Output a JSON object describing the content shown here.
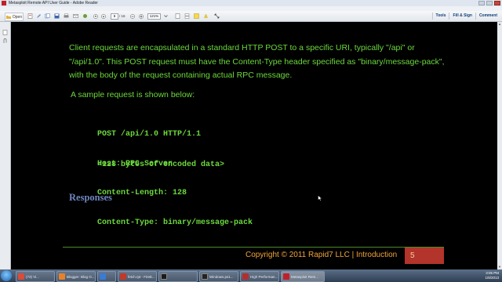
{
  "window": {
    "title": "Metasploit Remote API User Guide - Adobe Reader"
  },
  "menu": [
    "File",
    "Edit",
    "View",
    "Window",
    "Help"
  ],
  "toolbar": {
    "open_label": "Open",
    "page_current": "6",
    "page_total": "/ 16",
    "zoom": "121%",
    "tools_label": "Tools",
    "fill_sign_label": "Fill & Sign",
    "comment_label": "Comment"
  },
  "slide": {
    "paragraph": "Client requests are encapsulated in a standard HTTP POST to a specific URI, typically \"/api\" or \"/api/1.0\".  This POST request must have the Content-Type header specified as \"binary/message-pack\", with the body of the request containing actual RPC message.",
    "sample_intro": "A sample request is shown below:",
    "code_lines": [
      "POST /api/1.0 HTTP/1.1",
      "Host: RPC Server",
      "Content-Length: 128",
      "Content-Type: binary/message-pack"
    ],
    "encoded_data": "<128 bytes of encoded data>",
    "section_heading": "Responses",
    "footer": "Copyright © 2011 Rapid7 LLC | Introduction",
    "page_number": "5"
  },
  "taskbar": {
    "items": [
      {
        "label": "(73) Vi...",
        "color": "#d94b3a"
      },
      {
        "label": "Blogger: Blog O...",
        "color": "#e8822a"
      },
      {
        "label": "",
        "color": "#3a7bd5"
      },
      {
        "label": "fetch.rpt - FireE...",
        "color": "#c0392b"
      },
      {
        "label": "",
        "color": "#1a1a1a"
      },
      {
        "label": "Windows.ps1...",
        "color": "#222222"
      },
      {
        "label": "High Performan...",
        "color": "#b03030"
      },
      {
        "label": "Metasploit Rem...",
        "color": "#c0202a"
      }
    ],
    "time": "3:05 PM",
    "date": "1/8/2013"
  },
  "colors": {
    "slide_text": "#6cd93c",
    "heading": "#6f86c0",
    "footer_text": "#f2a43a",
    "badge": "#b2342a"
  }
}
